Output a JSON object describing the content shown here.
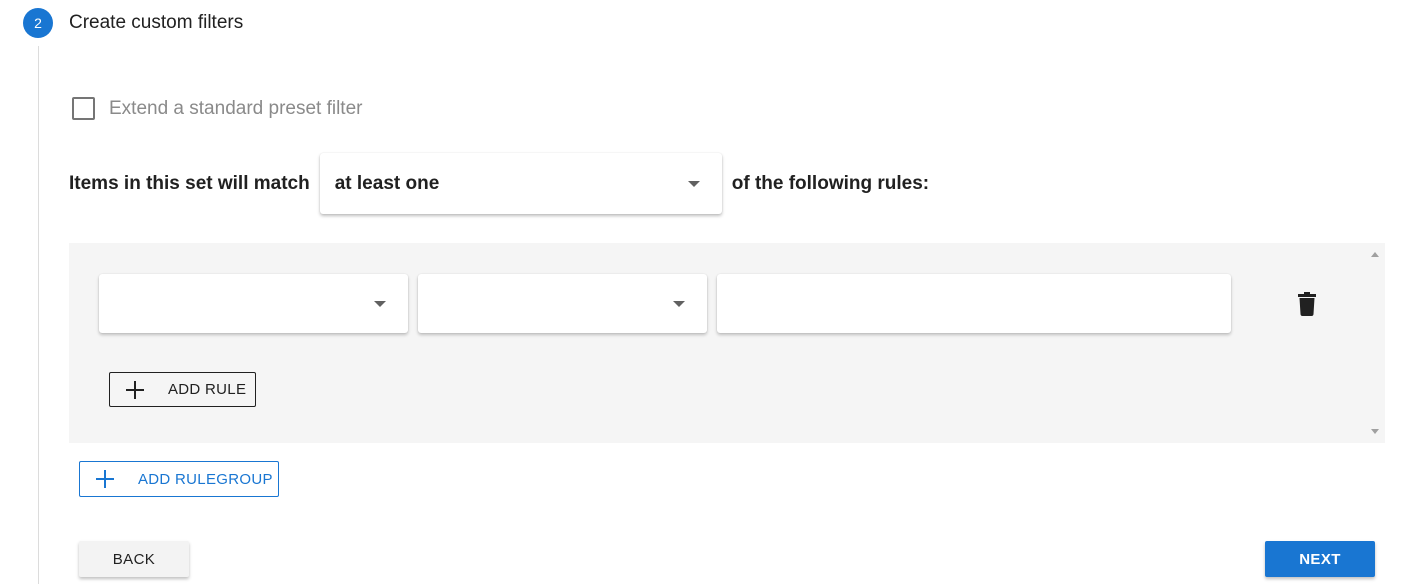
{
  "step": {
    "number": "2",
    "title": "Create custom filters"
  },
  "extend_checkbox": {
    "label": "Extend a standard preset filter",
    "checked": false
  },
  "match": {
    "prefix": "Items in this set will match",
    "selected": "at least one",
    "suffix": "of the following rules:"
  },
  "rule_group": {
    "rules": [
      {
        "field": "",
        "operator": "",
        "value": ""
      }
    ],
    "add_rule_label": "ADD RULE"
  },
  "add_rulegroup_label": "ADD RULEGROUP",
  "footer": {
    "back_label": "BACK",
    "next_label": "NEXT"
  },
  "icons": [
    "plus-icon",
    "trash-icon",
    "chevron-down-icon",
    "scroll-up-arrow",
    "scroll-down-arrow"
  ],
  "colors": {
    "primary": "#1976d2",
    "panel_bg": "#f5f5f5",
    "muted_text": "#8a8a8a"
  }
}
